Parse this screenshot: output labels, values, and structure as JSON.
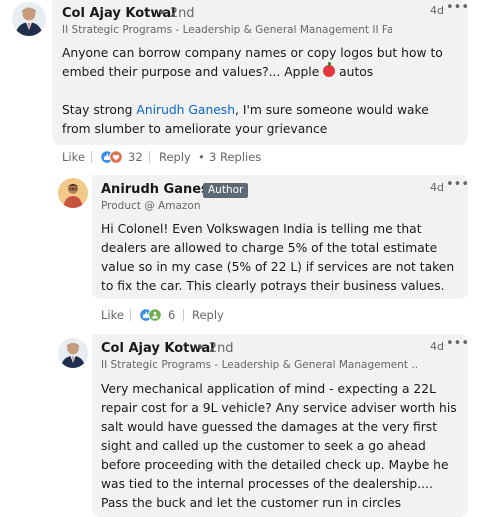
{
  "comments": [
    {
      "author": "Col Ajay Kotwal",
      "degree": "• 2nd",
      "headline": "II Strategic Programs - Leadership & General Management II Facilit...",
      "time": "4d",
      "body_1": "Anyone can borrow company names or copy logos but how to embed their purpose and values?... Apple",
      "body_1_after": "autos",
      "body_2_pre": "Stay strong ",
      "mention": "Anirudh Ganesh",
      "body_2_post": ", I'm sure someone would wake from slumber to ameliorate your grievance",
      "like_label": "Like",
      "reaction_count": "32",
      "reply_label": "Reply",
      "replies_label": "3 Replies"
    },
    {
      "author": "Anirudh Ganesh",
      "badge": "Author",
      "headline": "Product @ Amazon",
      "time": "4d",
      "body": "Hi Colonel! Even Volkswagen India is telling me that dealers are allowed to charge 5% of the total estimate value so in my case (5% of 22 L) if services are not taken to fix the car. This clearly potrays their business values.",
      "like_label": "Like",
      "reaction_count": "6",
      "reply_label": "Reply"
    },
    {
      "author": "Col Ajay Kotwal",
      "degree": "• 2nd",
      "headline": "II Strategic Programs - Leadership & General Management ...",
      "time": "4d",
      "body": "Very mechanical application of mind - expecting a 22L repair cost for a 9L vehicle? Any service adviser worth his salt would have guessed the damages at the very first sight and called up the customer to seek a go ahead before proceeding with the detailed check up. Maybe he was tied to the internal processes of the dealership.... Pass the buck and let the customer run in circles"
    }
  ],
  "colors": {
    "link": "#0a66c2",
    "bubble": "#f2f2f2",
    "muted": "#666666",
    "badge": "#5d6975"
  }
}
